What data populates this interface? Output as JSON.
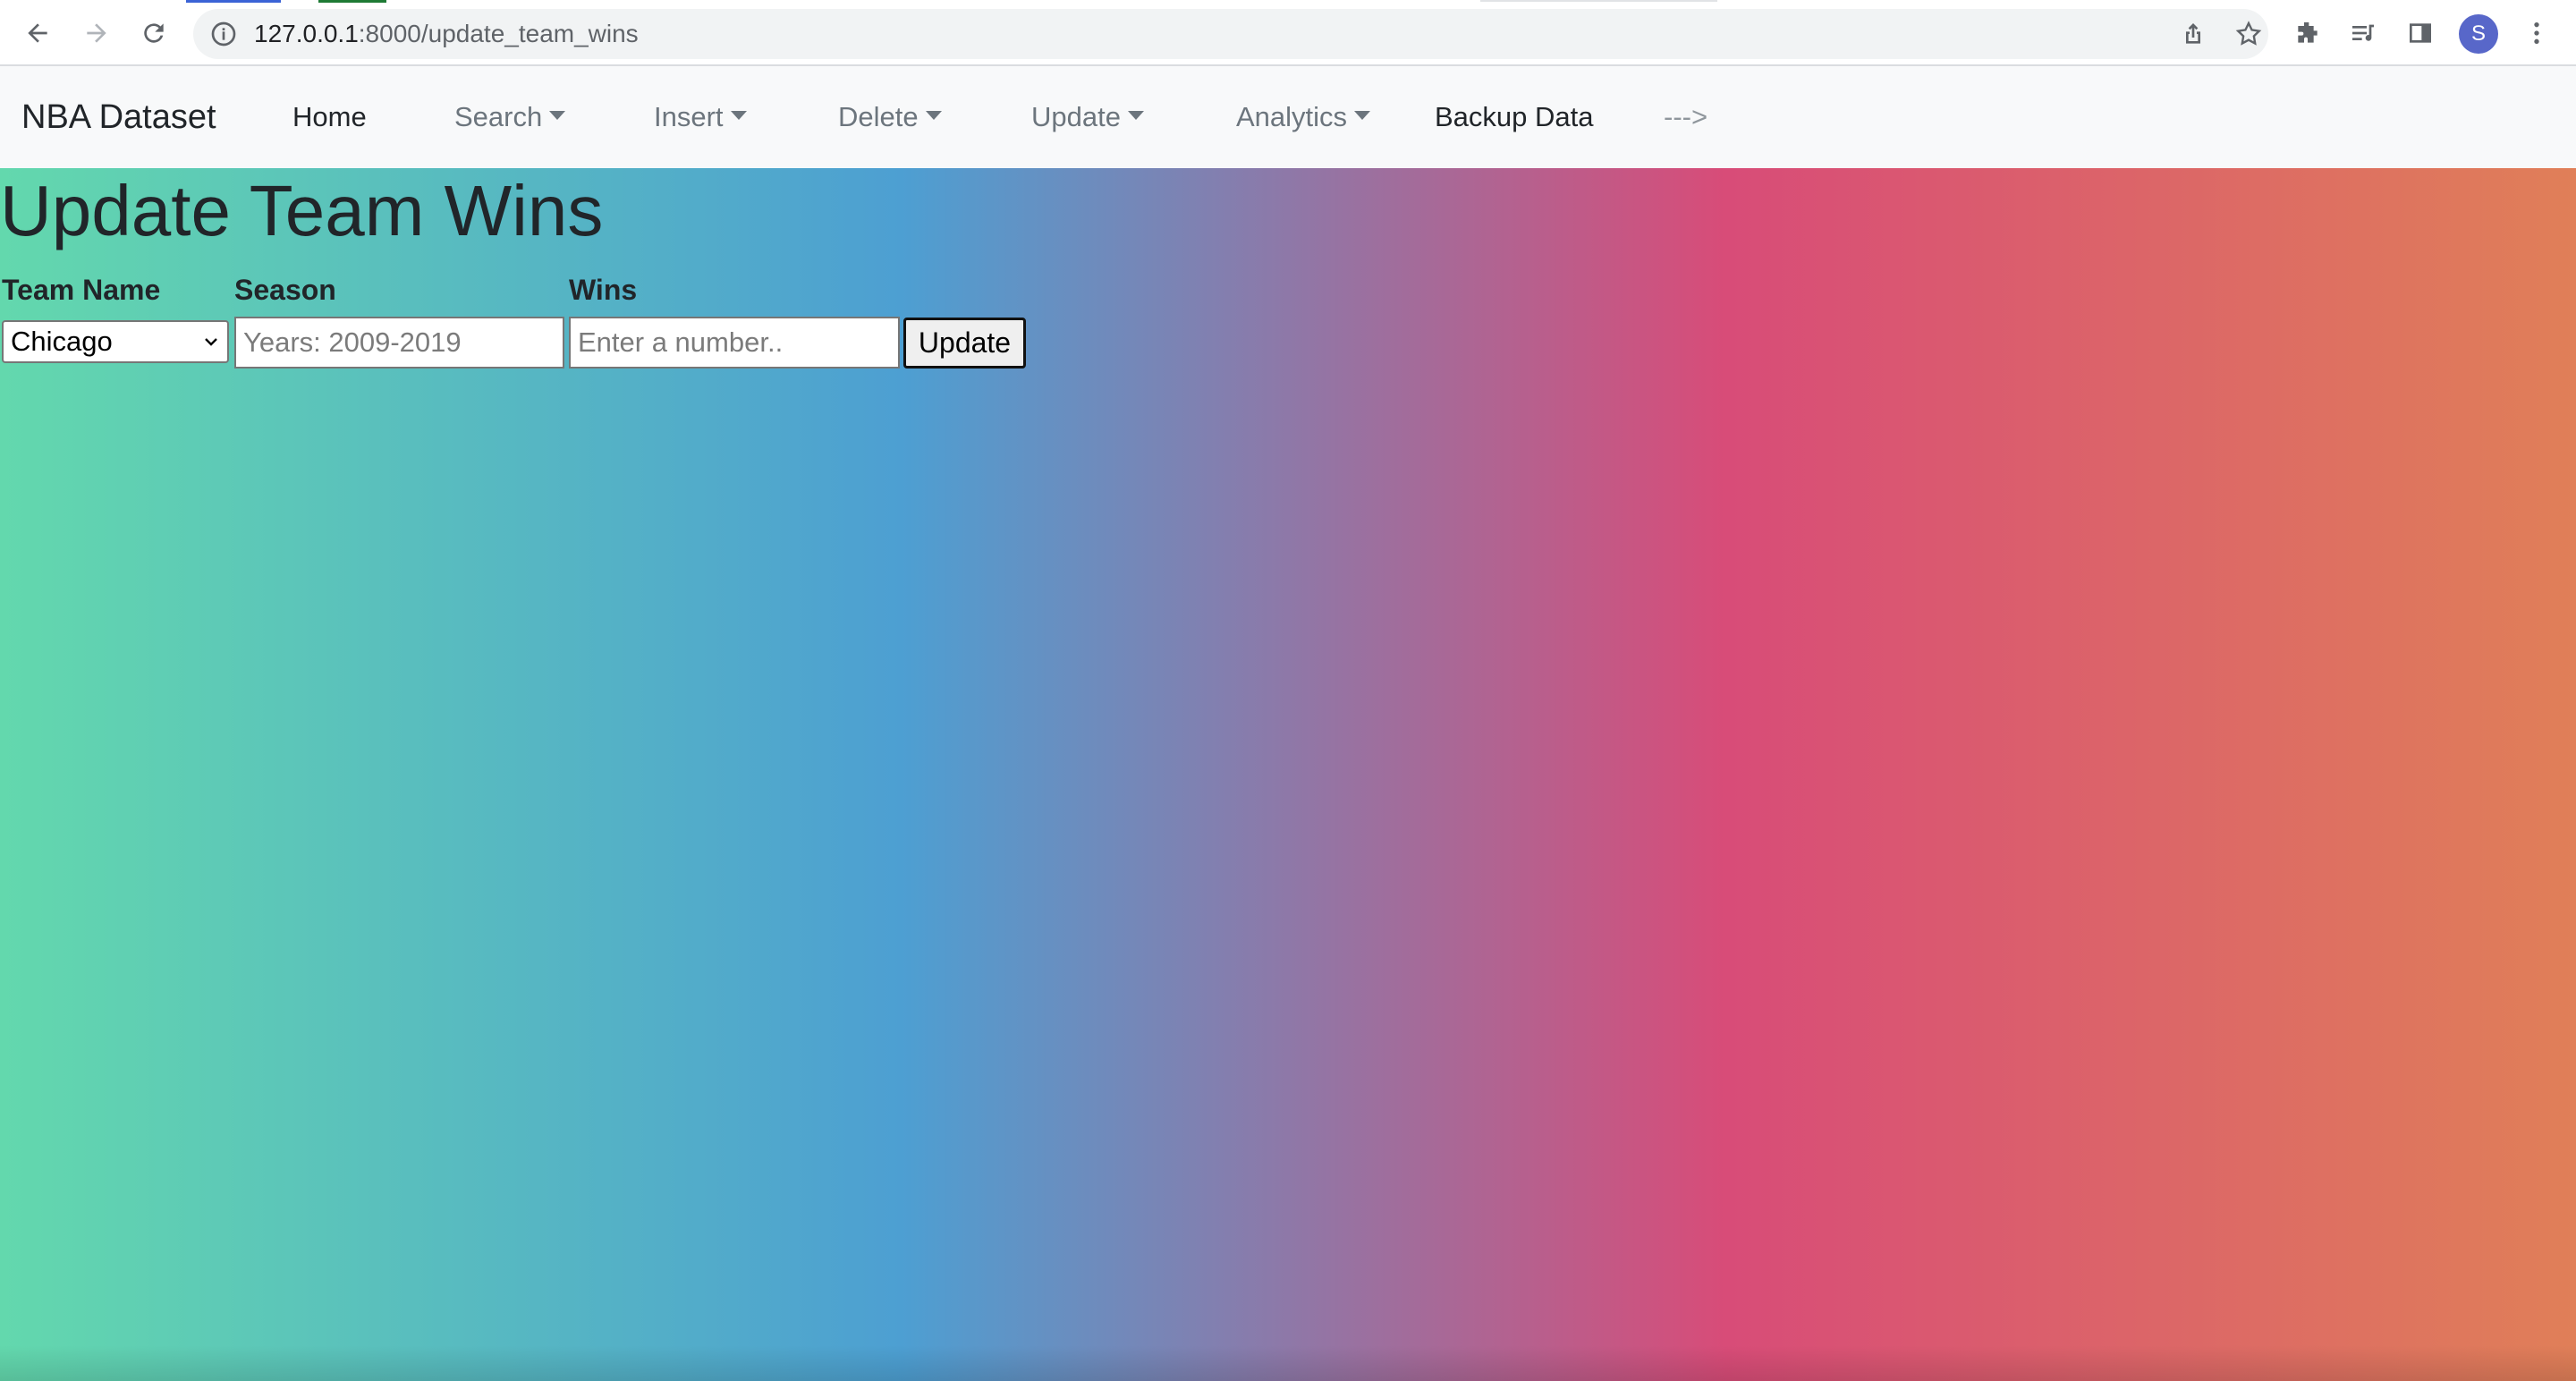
{
  "browser": {
    "url_host": "127.0.0.1",
    "url_path": ":8000/update_team_wins",
    "profile_initial": "S"
  },
  "navbar": {
    "brand": "NBA Dataset",
    "items": [
      {
        "label": "Home",
        "dropdown": false
      },
      {
        "label": "Search",
        "dropdown": true
      },
      {
        "label": "Insert",
        "dropdown": true
      },
      {
        "label": "Delete",
        "dropdown": true
      },
      {
        "label": "Update",
        "dropdown": true
      },
      {
        "label": "Analytics",
        "dropdown": true
      },
      {
        "label": "Backup Data",
        "dropdown": false
      },
      {
        "label": "--->",
        "dropdown": false
      }
    ]
  },
  "page": {
    "title": "Update Team Wins",
    "background_colors": [
      "#63d8ad",
      "#4d9fd2",
      "#d84c78",
      "#e07f58"
    ]
  },
  "form": {
    "team_label": "Team Name",
    "team_selected": "Chicago",
    "season_label": "Season",
    "season_placeholder": "Years: 2009-2019",
    "wins_label": "Wins",
    "wins_placeholder": "Enter a number..",
    "submit_label": "Update"
  }
}
